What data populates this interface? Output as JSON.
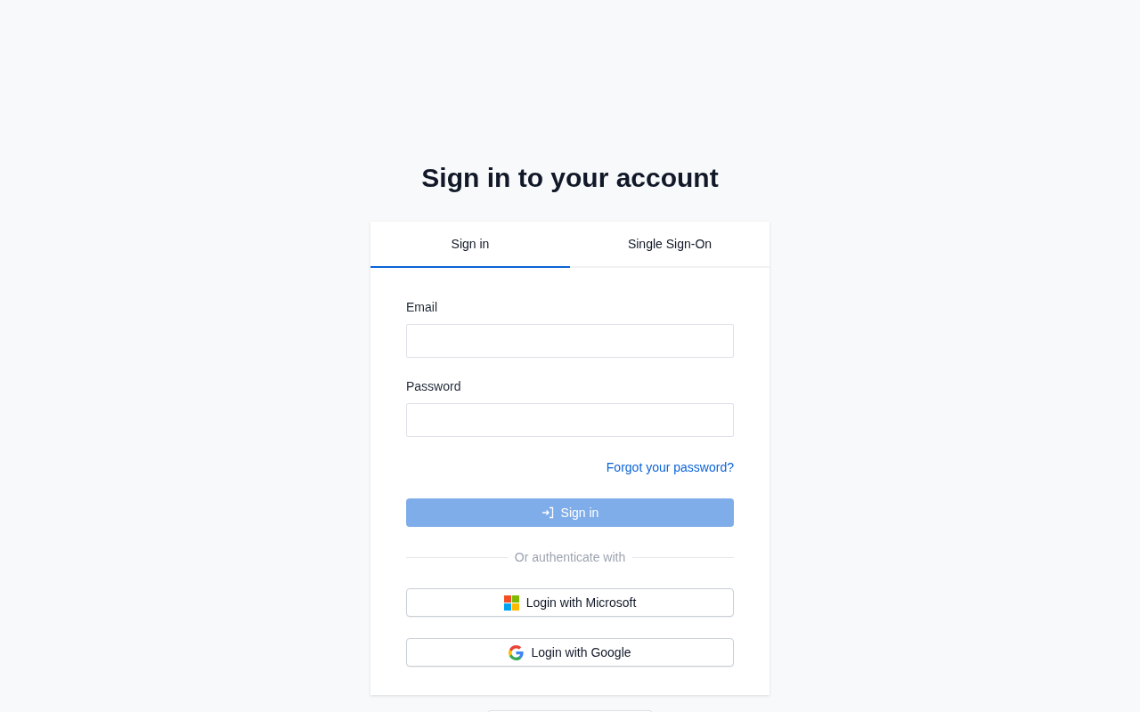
{
  "title": "Sign in to your account",
  "tabs": [
    {
      "label": "Sign in",
      "selected": true
    },
    {
      "label": "Single Sign-On",
      "selected": false
    }
  ],
  "fields": [
    {
      "label": "Email"
    },
    {
      "label": "Password"
    }
  ],
  "forgot_link": "Forgot your password?",
  "submit": {
    "label": "Sign in",
    "disabled": true
  },
  "divider": "Or authenticate with",
  "providers": [
    {
      "kind": "microsoft",
      "label": "Login with Microsoft"
    },
    {
      "kind": "google",
      "label": "Login with Google"
    }
  ]
}
